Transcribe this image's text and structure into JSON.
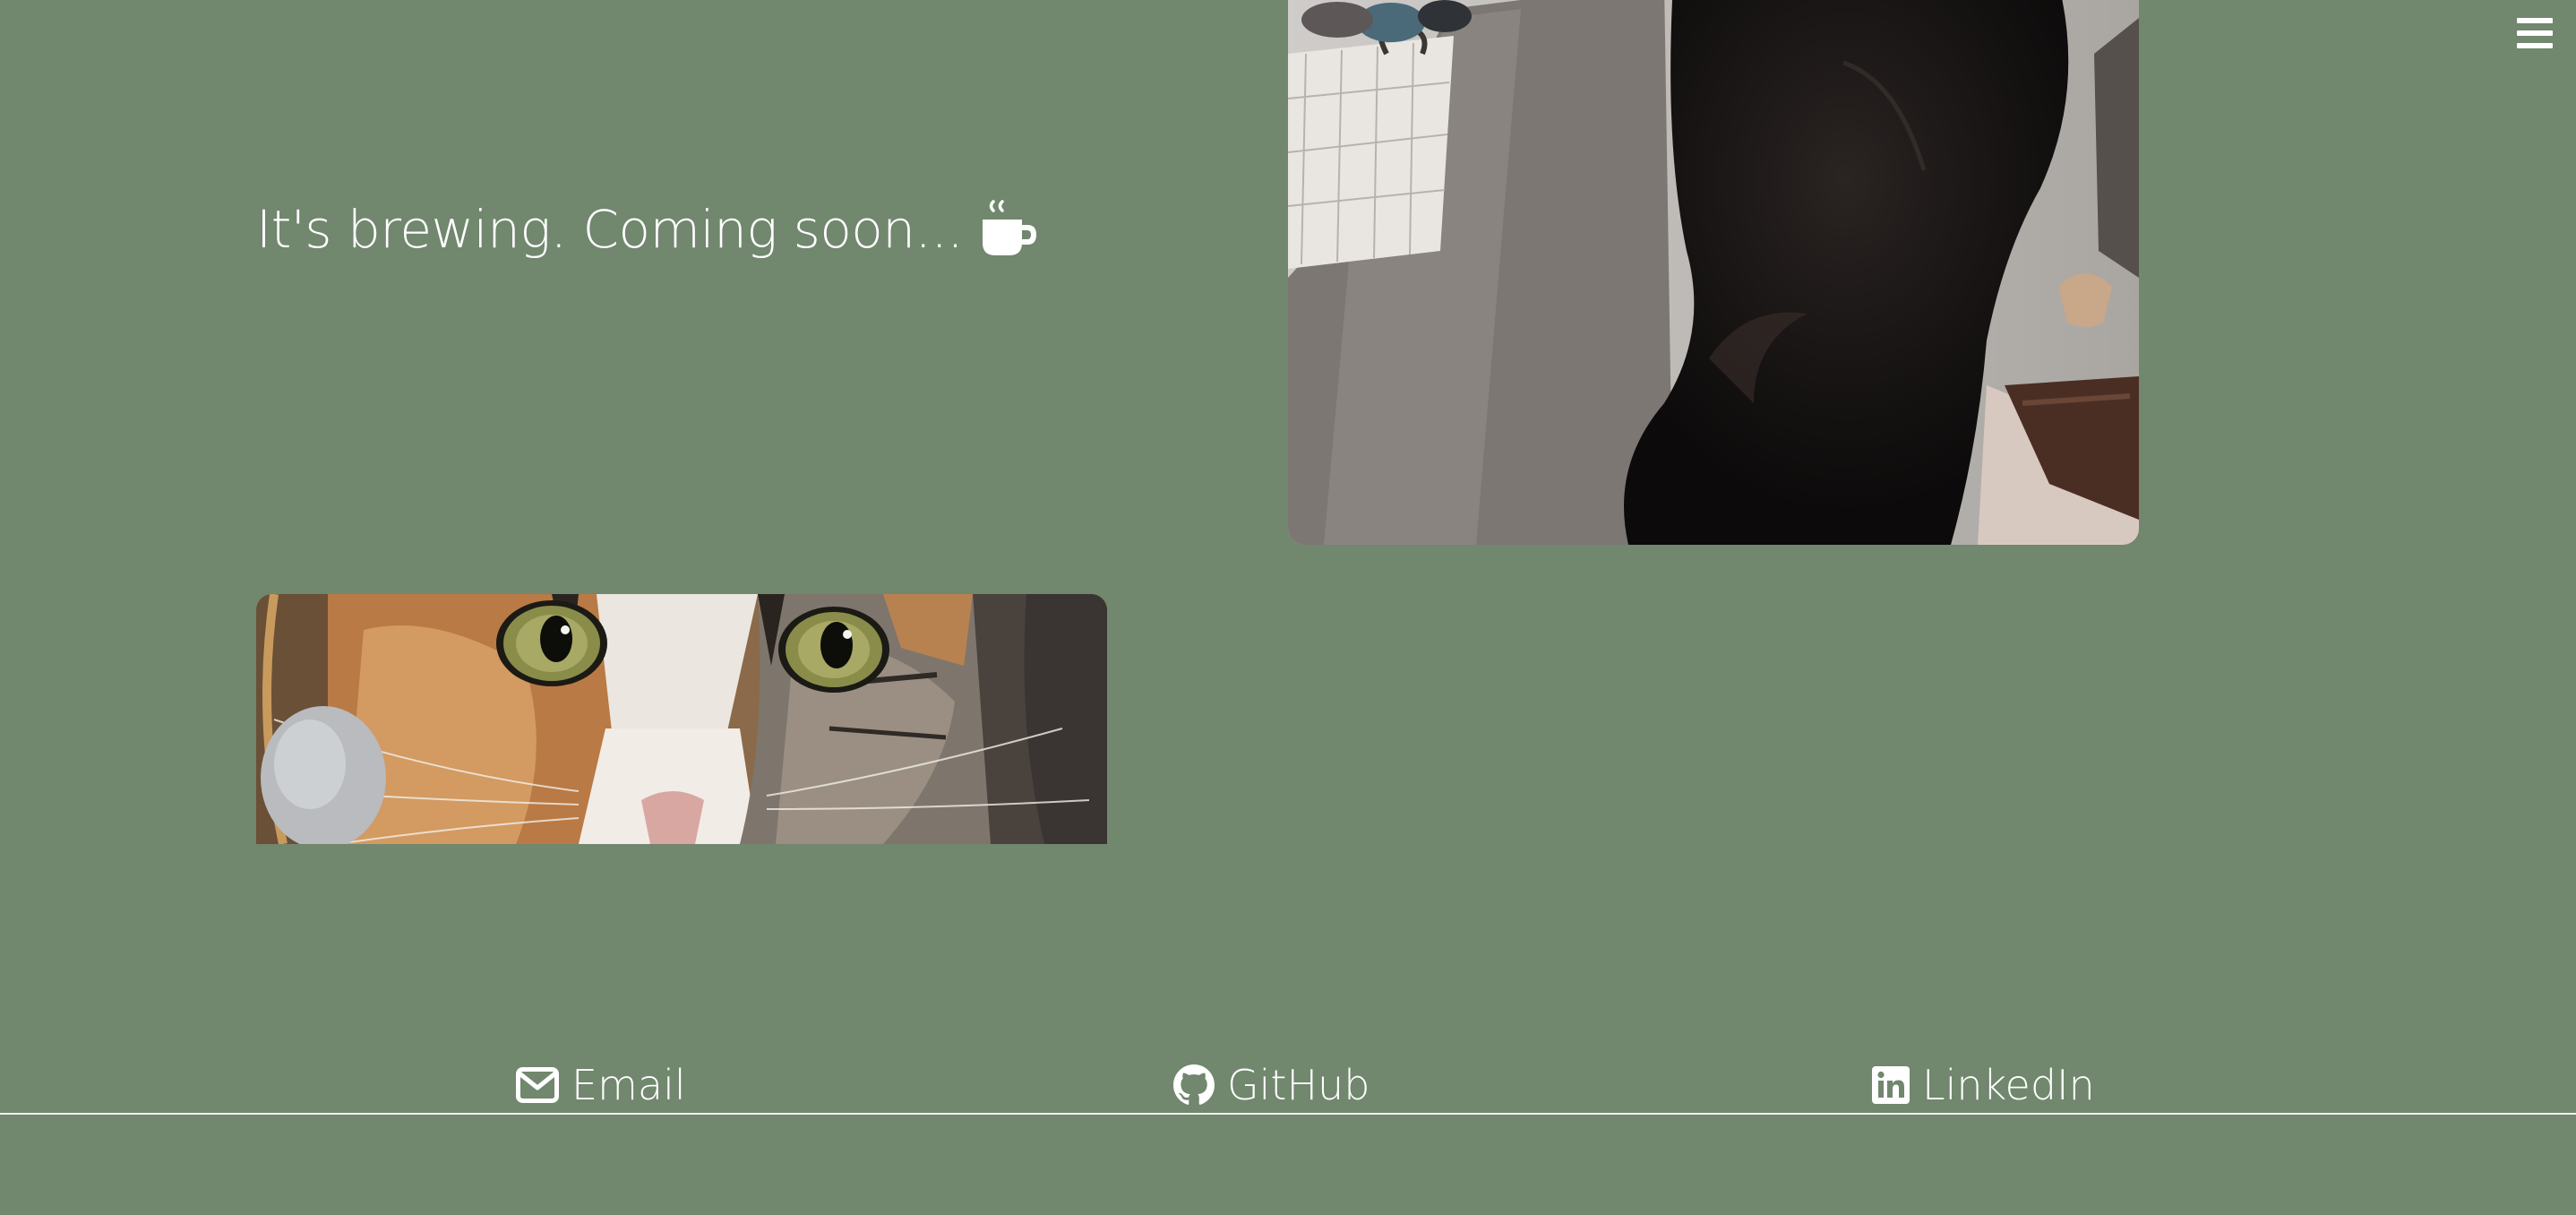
{
  "colors": {
    "background": "#71876e",
    "text": "#ffffff"
  },
  "nav": {
    "menu_icon": "hamburger-menu-icon"
  },
  "hero": {
    "text": "It's brewing. Coming soon...",
    "icon": "coffee-cup-icon"
  },
  "photos": [
    {
      "subject": "black cat"
    },
    {
      "subject": "calico cat eyes"
    }
  ],
  "footer": {
    "links": [
      {
        "label": "Email",
        "icon": "envelope-icon"
      },
      {
        "label": "GitHub",
        "icon": "github-icon"
      },
      {
        "label": "LinkedIn",
        "icon": "linkedin-icon"
      }
    ]
  }
}
